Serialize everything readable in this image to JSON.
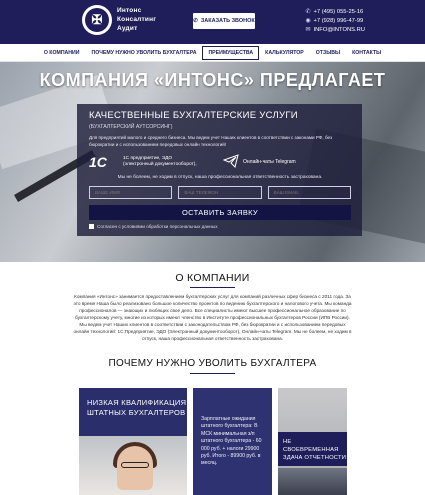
{
  "header": {
    "logo_text": [
      "Интонс",
      "Консалтинг",
      "Аудит"
    ],
    "call_button_label": "ЗАКАЗАТЬ ЗВОНОК",
    "phone1": "+7 (495) 055-25-16",
    "phone2": "+7 (928) 996-47-99",
    "email": "INFO@INTONS.RU"
  },
  "nav": {
    "items": [
      "О КОМПАНИИ",
      "ПОЧЕМУ НУЖНО УВОЛИТЬ БУХГАЛТЕРА",
      "ПРЕИМУЩЕСТВА",
      "КАЛЬКУЛЯТОР",
      "ОТЗЫВЫ",
      "КОНТАКТЫ"
    ],
    "active_index": 2
  },
  "hero": {
    "title": "КОМПАНИЯ «ИНТОНС» ПРЕДЛАГАЕТ",
    "panel_title": "КАЧЕСТВЕННЫЕ БУХГАЛТЕРСКИЕ УСЛУГИ",
    "panel_subtitle": "(БУХГАЛТЕРСКИЙ АУТСОРСИНГ)",
    "panel_desc": "Для предприятий малого и среднего бизнеса. Мы ведем учет Наших клиентов в соответствии с законами РФ, без бюрократии и с использованием передовых онлайн технологий!",
    "onec_logo": "1С",
    "onec_text": "1С предприятие, ЭДО (электронный документооборот),",
    "telegram_text": "Онлайн-чаты Telegram",
    "note": "Мы не болеем, не ходим в отпуск, наша профессиональная ответственность застрахована.",
    "fields": [
      {
        "placeholder": "ВАШЕ ИМЯ"
      },
      {
        "placeholder": "ВАШ ТЕЛЕФОН"
      },
      {
        "placeholder": "ВАШ EMAIL"
      }
    ],
    "submit_label": "ОСТАВИТЬ ЗАЯВКУ",
    "agree_text": "Согласен с условиями обработки персональных данных"
  },
  "about": {
    "title": "О КОМПАНИИ",
    "text": "Компания «Интонс» занимается предоставлением бухгалтерских услуг для компаний различных сфер бизнеса с 2011 года. За это время Наша было реализовано большое количество проектов по ведению бухгалтерского и налогового учета. Мы команда профессионалов — знающих и любящих свое дело. Все специалисты имеют высшее профессиональное образование по бухгалтерскому учету, многие из которых имеют членство в Институте профессиональных бухгалтеров России (ИПБ России). Мы ведем учет Наших клиентов в соответствии с законодательством РФ, без бюрократии и с использованием передовых онлайн технологий: 1С:Предприятие, ЭДО (Электронный документооборот), Онлайн-чаты Telegram. Мы не болеем, не ходим в отпуск, наша профессиональная ответственность застрахована."
  },
  "why": {
    "title": "ПОЧЕМУ НУЖНО УВОЛИТЬ БУХГАЛТЕРА",
    "card1_label": [
      "НИЗКАЯ КВАЛИФИКАЦИЯ",
      "ШТАТНЫХ БУХГАЛТЕРОВ"
    ],
    "card2_text": "Зарплатные ожидания штатного бухгалтера: В МСК минимальная з/п штатного бухгалтера - 60 000 руб. + налоги 29900 руб. Итого - 89900 руб. в месяц.",
    "card3_label": [
      "НЕ СВОЕВРЕМЕННАЯ",
      "ЗДАЧА ОТЧЕТНОСТИ"
    ]
  }
}
